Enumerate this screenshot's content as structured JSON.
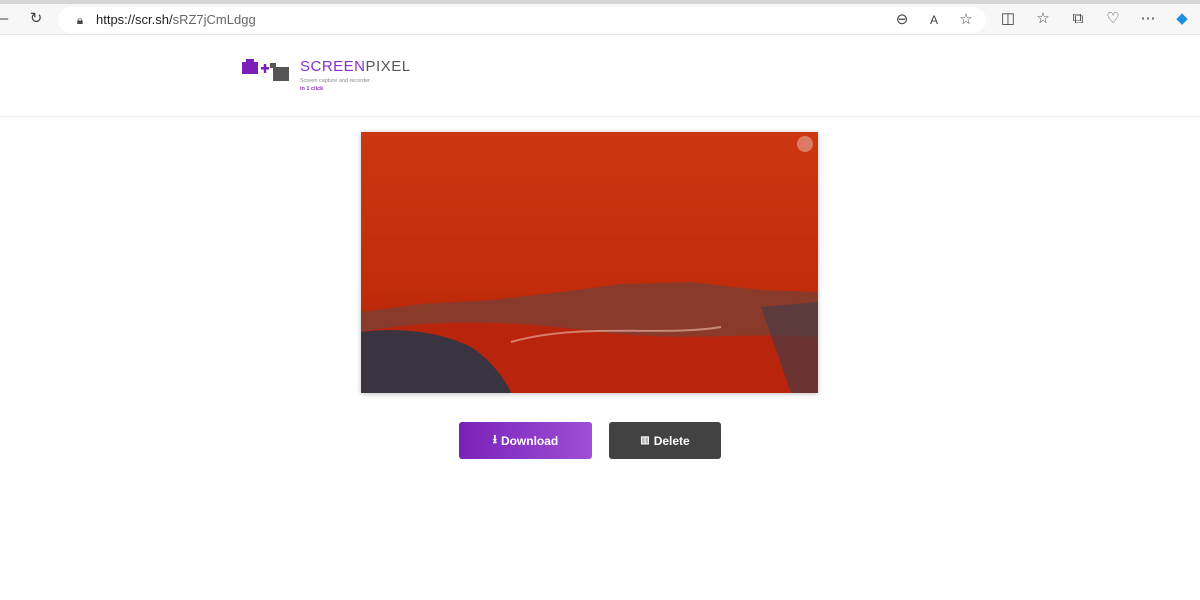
{
  "browser": {
    "url_host": "https://scr.sh/",
    "url_path": "sRZ7jCmLdgg"
  },
  "brand": {
    "name_accent": "SCREEN",
    "name_rest": "PIXEL",
    "tagline": "Screen capture and recorder",
    "tagline2": "in 1 click"
  },
  "actions": {
    "download": "Download",
    "delete": "Delete"
  },
  "colors": {
    "accent": "#8a2fc6",
    "delete": "#424242"
  }
}
